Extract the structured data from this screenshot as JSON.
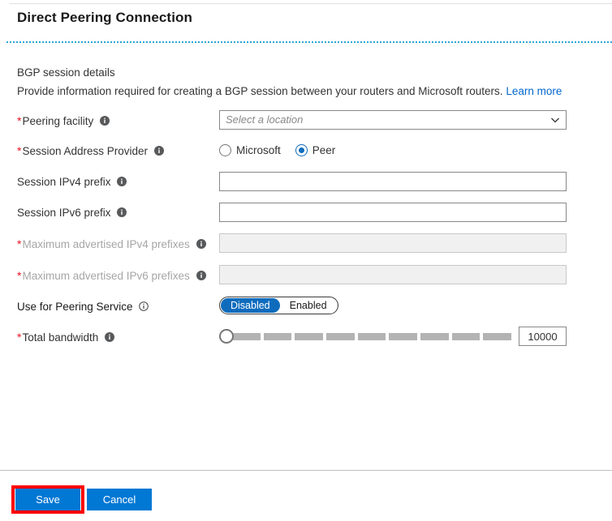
{
  "title": "Direct Peering Connection",
  "section": {
    "heading": "BGP session details",
    "description": "Provide information required for creating a BGP session between your routers and Microsoft routers.",
    "learn_more": "Learn more"
  },
  "rows": {
    "peering_facility": {
      "label": "Peering facility",
      "required": "*",
      "placeholder": "Select a location",
      "value": ""
    },
    "session_address_provider": {
      "label": "Session Address Provider",
      "required": "*",
      "options": [
        "Microsoft",
        "Peer"
      ],
      "selected": "Peer"
    },
    "session_ipv4_prefix": {
      "label": "Session IPv4 prefix",
      "value": "",
      "placeholder": ""
    },
    "session_ipv6_prefix": {
      "label": "Session IPv6 prefix",
      "value": "",
      "placeholder": ""
    },
    "max_advertised_ipv4": {
      "label": "Maximum advertised IPv4 prefixes",
      "required": "*",
      "value": "",
      "placeholder": ""
    },
    "max_advertised_ipv6": {
      "label": "Maximum advertised IPv6 prefixes",
      "required": "*",
      "value": "",
      "placeholder": ""
    },
    "use_for_peering_service": {
      "label": "Use for Peering Service",
      "options": [
        "Disabled",
        "Enabled"
      ],
      "selected": "Disabled"
    },
    "total_bandwidth": {
      "label": "Total bandwidth",
      "required": "*",
      "value": "10000",
      "slider_position_percent": 0,
      "segments": 9
    }
  },
  "footer": {
    "save_label": "Save",
    "cancel_label": "Cancel"
  },
  "colors": {
    "accent_blue": "#0078d4",
    "radio_blue": "#0f6cbd",
    "link_blue": "#0066cc",
    "required_red": "#e81123",
    "dashed_line": "#2aa5d6",
    "highlight_red": "#ff0000",
    "disabled_gray": "#a6a6a6"
  }
}
